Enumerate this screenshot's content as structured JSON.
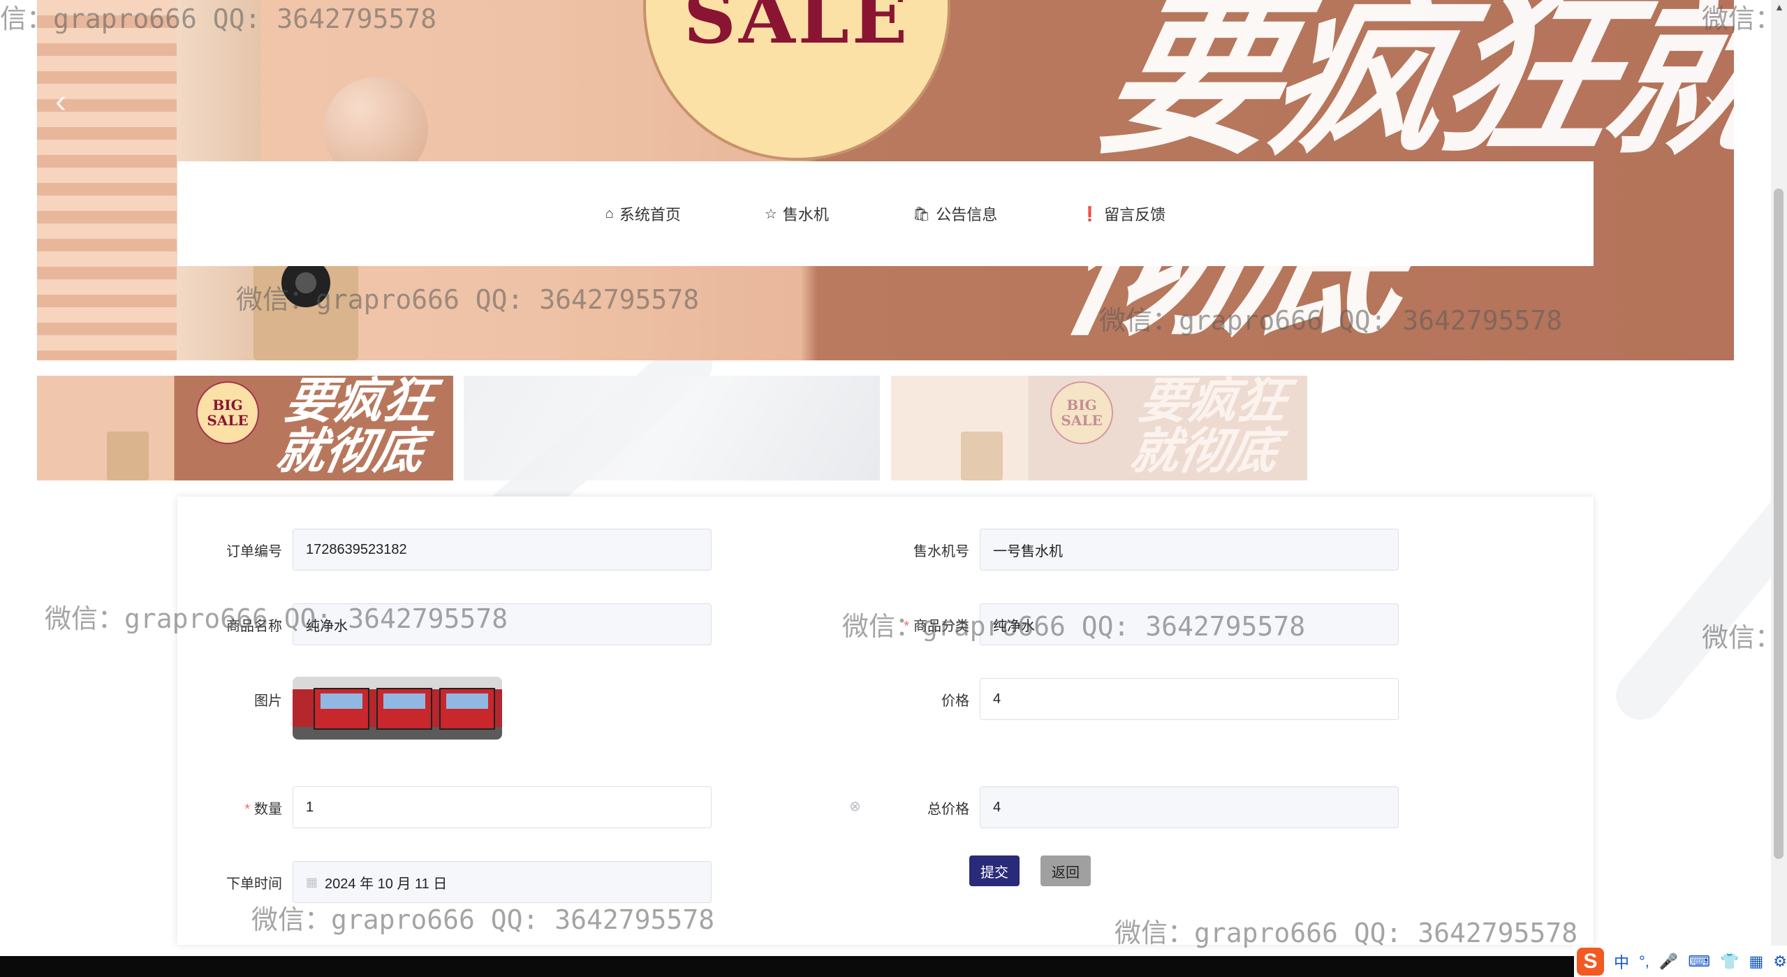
{
  "banner": {
    "sale_text": "SALE",
    "brush_text": "要疯狂就彻底",
    "prev_label": "‹",
    "next_label": "›"
  },
  "nav": {
    "items": [
      {
        "label": "系统首页",
        "icon": "home-icon"
      },
      {
        "label": "售水机",
        "icon": "star-icon"
      },
      {
        "label": "公告信息",
        "icon": "shopping-bag-icon"
      },
      {
        "label": "留言反馈",
        "icon": "alert-circle-icon"
      }
    ]
  },
  "thumbnails": {
    "big_sale_line1": "BIG",
    "big_sale_line2": "SALE",
    "brush_text": "要疯狂就彻底"
  },
  "form": {
    "order_no_label": "订单编号",
    "order_no_value": "1728639523182",
    "machine_no_label": "售水机号",
    "machine_no_value": "一号售水机",
    "product_name_label": "商品名称",
    "product_name_value": "纯净水",
    "category_label": "商品分类",
    "category_value": "纯净水",
    "image_label": "图片",
    "price_label": "价格",
    "price_value": "4",
    "qty_label": "数量",
    "qty_value": "1",
    "total_label": "总价格",
    "total_value": "4",
    "order_time_label": "下单时间",
    "order_time_value": "2024 年 10 月 11 日",
    "submit_label": "提交",
    "back_label": "返回"
  },
  "watermark": {
    "text": "微信：grapro666 QQ: 3642795578",
    "edge_left": "信：grapro666 QQ: 3642795578",
    "edge_right": "微信：",
    "edge_right_mid": "微信："
  },
  "ime": {
    "logo": "S",
    "items": [
      "中",
      "°,",
      "🎤",
      "⌨",
      "👕",
      "▦",
      "⚙"
    ]
  },
  "colors": {
    "submit_bg": "#2a2a7a",
    "back_bg": "#a0a0a0",
    "required": "#f56c6c"
  }
}
